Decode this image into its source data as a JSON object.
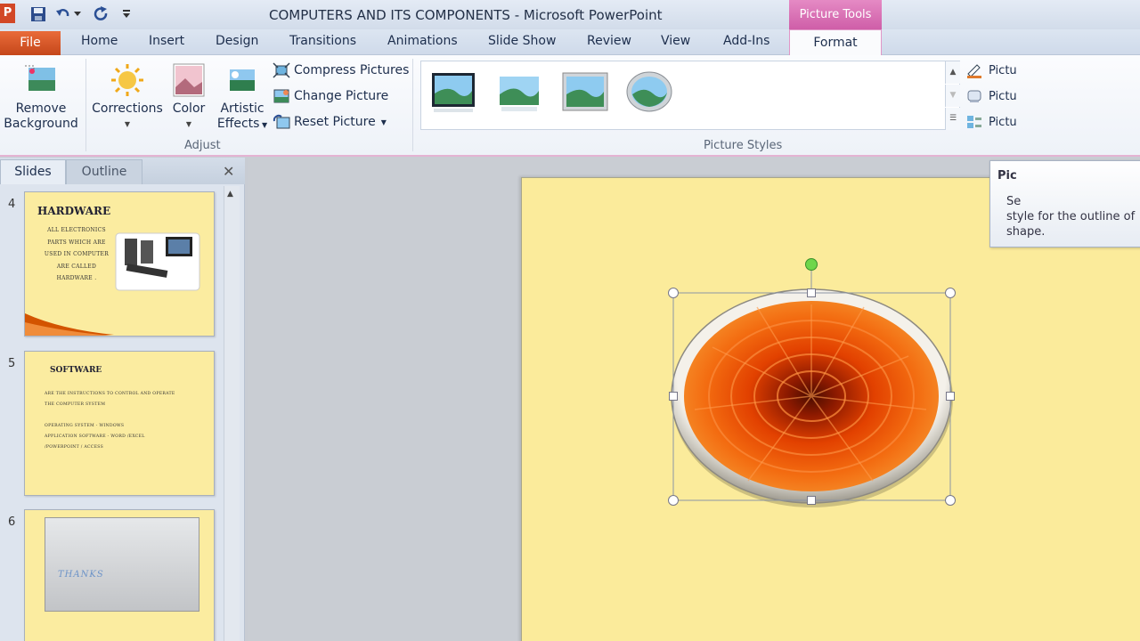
{
  "titlebar": {
    "app_letter": "P",
    "title": "COMPUTERS AND ITS COMPONENTS  -  Microsoft PowerPoint",
    "context_tab": "Picture Tools"
  },
  "tabs": [
    "File",
    "Home",
    "Insert",
    "Design",
    "Transitions",
    "Animations",
    "Slide Show",
    "Review",
    "View",
    "Add-Ins",
    "Format"
  ],
  "ribbon": {
    "adjust": {
      "remove_bg_line1": "Remove",
      "remove_bg_line2": "Background",
      "corrections": "Corrections",
      "color": "Color",
      "artistic_line1": "Artistic",
      "artistic_line2": "Effects",
      "compress": "Compress Pictures",
      "change": "Change Picture",
      "reset": "Reset Picture",
      "group_label": "Adjust"
    },
    "picture_styles": {
      "group_label": "Picture Styles",
      "options": [
        "Pictu",
        "Pictu",
        "Pictu"
      ]
    }
  },
  "left_pane": {
    "tab_slides": "Slides",
    "tab_outline": "Outline",
    "close_glyph": "✕",
    "slides": [
      {
        "num": "4",
        "title": "HARDWARE",
        "lines": [
          "ALL ELECTRONICS",
          "PARTS WHICH ARE",
          "USED IN COMPUTER",
          "ARE CALLED",
          "HARDWARE ."
        ]
      },
      {
        "num": "5",
        "title": "SOFTWARE",
        "lines": [
          "ARE THE INSTRUCTIONS TO CONTROL AND OPERATE",
          "THE COMPUTER SYSTEM",
          "",
          "OPERATING SYSTEM - WINDOWS",
          "APPLICATION SOFTWARE - WORD /EXCEL",
          "/POWERPOINT / ACCESS"
        ]
      },
      {
        "num": "6",
        "title": "THANKS",
        "lines": []
      }
    ]
  },
  "tooltip": {
    "title": "Pic",
    "body_line1": "Se",
    "body_line2": "style for the outline of",
    "body_line3": "shape."
  },
  "icons": {
    "save": "save-icon",
    "undo": "undo-icon",
    "redo": "redo-icon",
    "customize": "customize-qat-icon",
    "rotate": "rotate-handle-icon"
  },
  "colors": {
    "file_tab": "#d44a1d",
    "context_tab": "#d865b0",
    "slide_bg": "#fbeb9b",
    "thumb_bg": "#fbeca0"
  }
}
